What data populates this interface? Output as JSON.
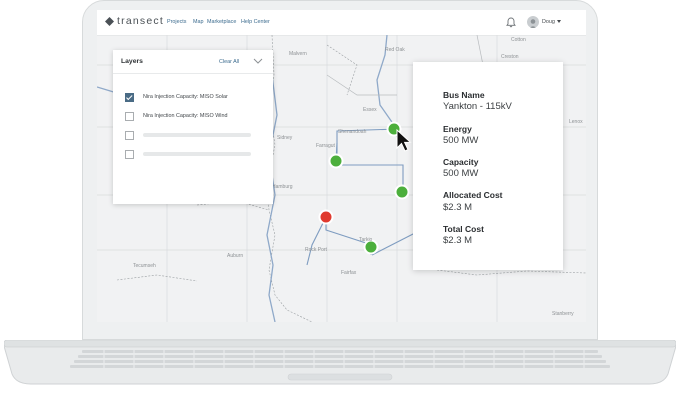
{
  "app": {
    "brand": "transect",
    "nav": [
      "Projects",
      "Map",
      "Marketplace",
      "Help Center"
    ],
    "user": "Doug"
  },
  "layers": {
    "title": "Layers",
    "clear_all": "Clear All",
    "items": [
      {
        "label": "Nira Injection Capacity: MISO Solar",
        "checked": true
      },
      {
        "label": "Nira Injection Capacity: MISO Wind",
        "checked": false
      }
    ]
  },
  "towns": [
    "Red Oak",
    "Malvern",
    "Essex",
    "Shenandoah",
    "Sidney",
    "Farragut",
    "Hamburg",
    "Tarkio",
    "Rock Port",
    "Fairfax",
    "Tecumseh",
    "Auburn",
    "Cotton",
    "Creston",
    "Lenox",
    "Stanberry"
  ],
  "bus": {
    "labels": {
      "name": "Bus Name",
      "energy": "Energy",
      "capacity": "Capacity",
      "allocated_cost": "Allocated Cost",
      "total_cost": "Total Cost"
    },
    "values": {
      "name": "Yankton - 115kV",
      "energy": "500 MW",
      "capacity": "500 MW",
      "allocated_cost": "$2.3 M",
      "total_cost": "$2.3 M"
    }
  },
  "colors": {
    "node_ok": "#4caf3c",
    "node_alert": "#e03a2f",
    "river": "#8fa9c9",
    "brand": "#3d6c8f"
  }
}
